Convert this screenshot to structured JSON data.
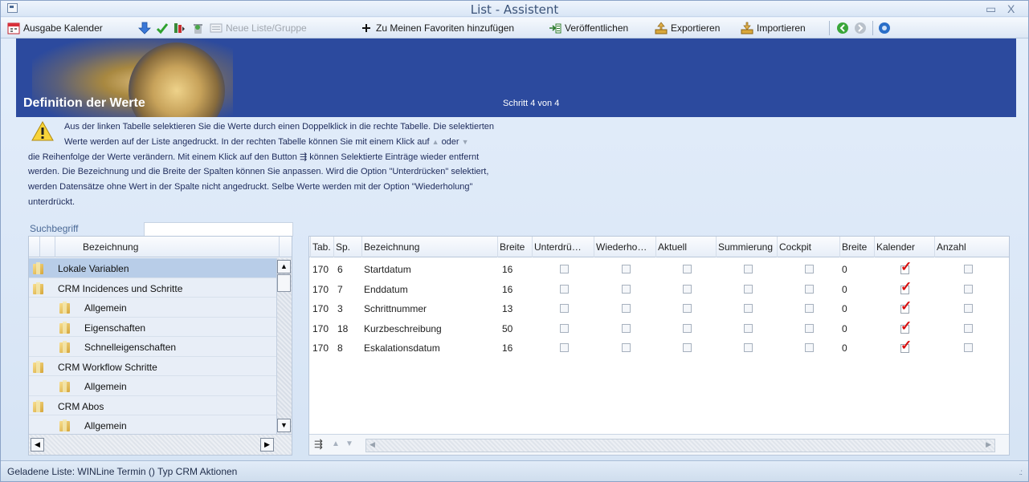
{
  "window": {
    "title": "List - Assistent",
    "min_glyph": "▭",
    "close_glyph": "X"
  },
  "toolbar": {
    "calendar_output": "Ausgabe Kalender",
    "new_list_group": "Neue Liste/Gruppe",
    "add_favorites": "Zu Meinen Favoriten hinzufügen",
    "publish": "Veröffentlichen",
    "export": "Exportieren",
    "import": "Importieren",
    "icons": [
      "calendar-icon",
      "down-arrow-icon",
      "checkmark-icon",
      "columns-icon",
      "recycle-icon",
      "list-icon",
      "plus-icon",
      "publish-icon",
      "export-icon",
      "import-icon",
      "back-icon",
      "forward-icon",
      "help-icon"
    ]
  },
  "banner": {
    "heading": "Definition der Werte",
    "step": "Schritt 4 von 4"
  },
  "info": {
    "line1": "Aus der linken Tabelle selektieren Sie die Werte durch einen Doppelklick in die rechte Tabelle. Die selektierten",
    "line2a": "Werte werden auf der Liste angedruckt. In der rechten Tabelle können Sie mit einem Klick auf",
    "line2b": "oder",
    "line3a": "die Reihenfolge der Werte verändern. Mit einem Klick auf den Button",
    "line3b": "können Selektierte Einträge wieder entfernt",
    "line4": "werden. Die Bezeichnung und die Breite der Spalten können Sie anpassen. Wird die Option \"Unterdrücken\" selektiert,",
    "line5": "werden Datensätze ohne Wert in der Spalte nicht angedruckt. Selbe Werte werden mit der Option \"Wiederholung\"",
    "line6": "unterdrückt."
  },
  "search": {
    "label": "Suchbegriff",
    "value": "",
    "placeholder": ""
  },
  "left_grid": {
    "header": "Bezeichnung",
    "rows": [
      {
        "label": "Lokale Variablen",
        "level": 0,
        "selected": true
      },
      {
        "label": "CRM Incidences und Schritte",
        "level": 0,
        "selected": false
      },
      {
        "label": "Allgemein",
        "level": 1,
        "selected": false
      },
      {
        "label": "Eigenschaften",
        "level": 1,
        "selected": false
      },
      {
        "label": "Schnelleigenschaften",
        "level": 1,
        "selected": false
      },
      {
        "label": "CRM Workflow Schritte",
        "level": 0,
        "selected": false
      },
      {
        "label": "Allgemein",
        "level": 1,
        "selected": false
      },
      {
        "label": "CRM Abos",
        "level": 0,
        "selected": false
      },
      {
        "label": "Allgemein",
        "level": 1,
        "selected": false
      }
    ]
  },
  "right_grid": {
    "columns": [
      "Tab.",
      "Sp.",
      "Bezeichnung",
      "Breite",
      "Unterdrü…",
      "Wiederho…",
      "Aktuell",
      "Summierung",
      "Cockpit",
      "Breite",
      "Kalender",
      "Anzahl"
    ],
    "rows": [
      {
        "tab": "170",
        "sp": "6",
        "bez": "Startdatum",
        "breite": "16",
        "unterdruecken": false,
        "wiederholung": false,
        "aktuell": false,
        "summierung": false,
        "cockpit": false,
        "breite2": "0",
        "kalender": true,
        "anzahl": false
      },
      {
        "tab": "170",
        "sp": "7",
        "bez": "Enddatum",
        "breite": "16",
        "unterdruecken": false,
        "wiederholung": false,
        "aktuell": false,
        "summierung": false,
        "cockpit": false,
        "breite2": "0",
        "kalender": true,
        "anzahl": false
      },
      {
        "tab": "170",
        "sp": "3",
        "bez": "Schrittnummer",
        "breite": "13",
        "unterdruecken": false,
        "wiederholung": false,
        "aktuell": false,
        "summierung": false,
        "cockpit": false,
        "breite2": "0",
        "kalender": true,
        "anzahl": false
      },
      {
        "tab": "170",
        "sp": "18",
        "bez": "Kurzbeschreibung",
        "breite": "50",
        "unterdruecken": false,
        "wiederholung": false,
        "aktuell": false,
        "summierung": false,
        "cockpit": false,
        "breite2": "0",
        "kalender": true,
        "anzahl": false
      },
      {
        "tab": "170",
        "sp": "8",
        "bez": "Eskalationsdatum",
        "breite": "16",
        "unterdruecken": false,
        "wiederholung": false,
        "aktuell": false,
        "summierung": false,
        "cockpit": false,
        "breite2": "0",
        "kalender": true,
        "anzahl": false
      }
    ]
  },
  "status": {
    "text": "Geladene Liste: WINLine Termin () Typ CRM Aktionen"
  },
  "colors": {
    "banner": "#2c4a9e",
    "accent_check": "#d81010",
    "selection": "#b8cde8"
  }
}
